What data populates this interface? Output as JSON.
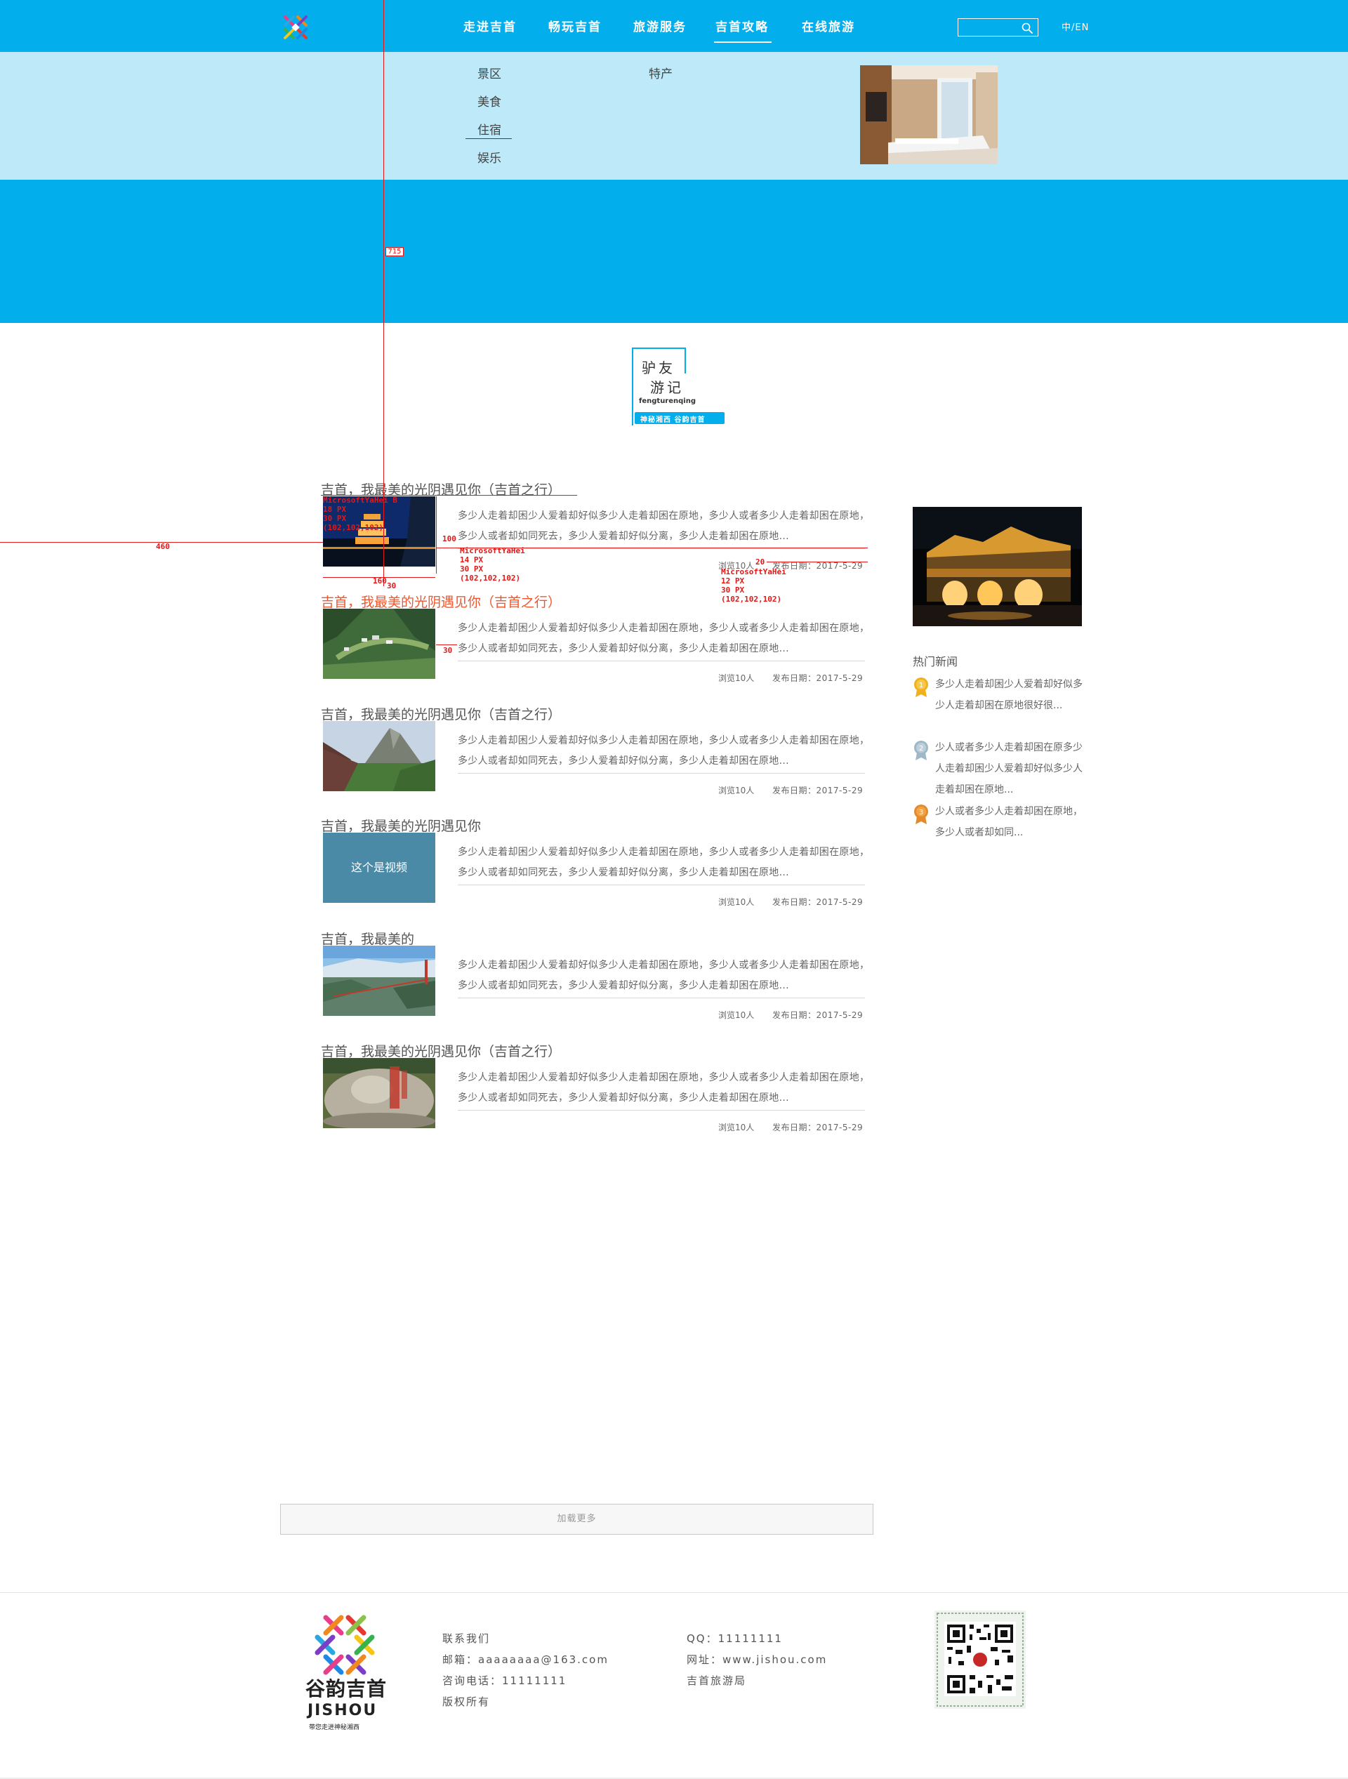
{
  "header": {
    "nav": [
      "走进吉首",
      "畅玩吉首",
      "旅游服务",
      "吉首攻略",
      "在线旅游"
    ],
    "active_index": 3,
    "search": {
      "placeholder": "",
      "value": ""
    },
    "lang": "中/EN",
    "accent": "#02aeec"
  },
  "dropdown": {
    "left_items": [
      "景区",
      "美食",
      "住宿",
      "娱乐"
    ],
    "selected": "住宿",
    "right_items": [
      "特产"
    ],
    "background": "#bde9f8"
  },
  "section": {
    "title_line1": "驴友",
    "title_line2": "游记",
    "pinyin": "fengturenqing",
    "tag": "神秘湘西 谷韵吉首"
  },
  "measurements": {
    "v_label": "715",
    "h_label": "460",
    "title_spec": "MicrosoftYaHei B\n18 PX\n30 PX\n(102,102,102)",
    "body_spec": "MicrosoftYaHei\n14 PX\n30 PX\n(102,102,102)",
    "meta_spec": "MicrosoftYaHei\n12 PX\n30 PX\n(102,102,102)",
    "thumb_w": "160",
    "thumb_h": "100",
    "gap_small": "30",
    "gap_right": "30",
    "meta_gap": "20"
  },
  "articles": [
    {
      "title": "吉首，我最美的光阴遇见你（吉首之行）",
      "highlight": false,
      "thumb": "pagoda-night",
      "body": "多少人走着却困少人爱着却好似多少人走着却困在原地，多少人或者多少人走着却困在原地，多少人或者却如同死去，多少人爱着却好似分离，多少人走着却困在原地...",
      "views": "浏览10人",
      "date": "发布日期：2017-5-29"
    },
    {
      "title": "吉首，我最美的光阴遇见你（吉首之行）",
      "highlight": true,
      "thumb": "valley-village",
      "body": "多少人走着却困少人爱着却好似多少人走着却困在原地，多少人或者多少人走着却困在原地，多少人或者却如同死去，多少人爱着却好似分离，多少人走着却困在原地...",
      "views": "浏览10人",
      "date": "发布日期：2017-5-29"
    },
    {
      "title": "吉首，我最美的光阴遇见你（吉首之行）",
      "highlight": false,
      "thumb": "mountain-peak",
      "body": "多少人走着却困少人爱着却好似多少人走着却困在原地，多少人或者多少人走着却困在原地，多少人或者却如同死去，多少人爱着却好似分离，多少人走着却困在原地...",
      "views": "浏览10人",
      "date": "发布日期：2017-5-29"
    },
    {
      "title": "吉首，我最美的光阴遇见你",
      "highlight": false,
      "thumb": "video",
      "video_label": "这个是视频",
      "body": "多少人走着却困少人爱着却好似多少人走着却困在原地，多少人或者多少人走着却困在原地，多少人或者却如同死去，多少人爱着却好似分离，多少人走着却困在原地...",
      "views": "浏览10人",
      "date": "发布日期：2017-5-29"
    },
    {
      "title": "吉首，我最美的",
      "highlight": false,
      "thumb": "bridge",
      "body": "多少人走着却困少人爱着却好似多少人走着却困在原地，多少人或者多少人走着却困在原地，多少人或者却如同死去，多少人爱着却好似分离，多少人走着却困在原地...",
      "views": "浏览10人",
      "date": "发布日期：2017-5-29"
    },
    {
      "title": "吉首，我最美的光阴遇见你（吉首之行）",
      "highlight": false,
      "thumb": "stone-carving",
      "body": "多少人走着却困少人爱着却好似多少人走着却困在原地，多少人或者多少人走着却困在原地，多少人或者却如同死去，多少人爱着却好似分离，多少人走着却困在原地...",
      "views": "浏览10人",
      "date": "发布日期：2017-5-29"
    }
  ],
  "sidebar": {
    "hot_title": "热门新闻",
    "hot": [
      {
        "rank": "1",
        "text": "多少人走着却困少人爱着却好似多少人走着却困在原地很好很...",
        "color": "#f2b01e"
      },
      {
        "rank": "2",
        "text": "少人或者多少人走着却困在原多少人走着却困少人爱着却好似多少人走着却困在原地...",
        "color": "#9fb8c8"
      },
      {
        "rank": "3",
        "text": "少人或者多少人走着却困在原地，多少人或者却如同...",
        "color": "#e58a2a"
      }
    ]
  },
  "load_more": "加载更多",
  "footer": {
    "logo_text": "谷韵吉首",
    "logo_en": "JISHOU",
    "logo_tag": "带您走进神秘湘西",
    "col1": [
      "联系我们",
      "邮箱：aaaaaaaa@163.com",
      "咨询电话：11111111",
      "版权所有"
    ],
    "col2": [
      "QQ：11111111",
      "网址：www.jishou.com",
      "吉首旅游局"
    ]
  }
}
